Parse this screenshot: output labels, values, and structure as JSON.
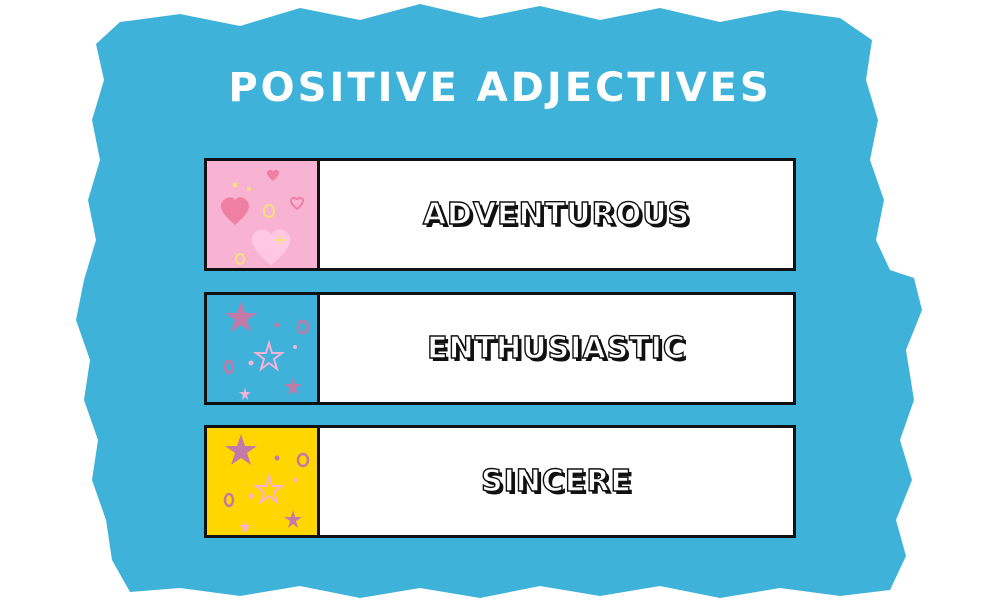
{
  "title": "POSITIVE ADJECTIVES",
  "items": [
    {
      "word": "ADVENTUROUS",
      "swatch_color": "#f8b3d3",
      "pattern": "hearts-icon"
    },
    {
      "word": "ENTHUSIASTIC",
      "swatch_color": "#3fb2d9",
      "pattern": "stars-icon"
    },
    {
      "word": "SINCERE",
      "swatch_color": "#ffd600",
      "pattern": "stars-icon"
    }
  ],
  "colors": {
    "background": "#ffffff",
    "brush_blob": "#3fb2d9",
    "text_fill": "#ffffff",
    "outline": "#111111",
    "heart": "#f07fa4",
    "star_mauve": "#c27aa8",
    "star_pink": "#f5b3d9"
  }
}
